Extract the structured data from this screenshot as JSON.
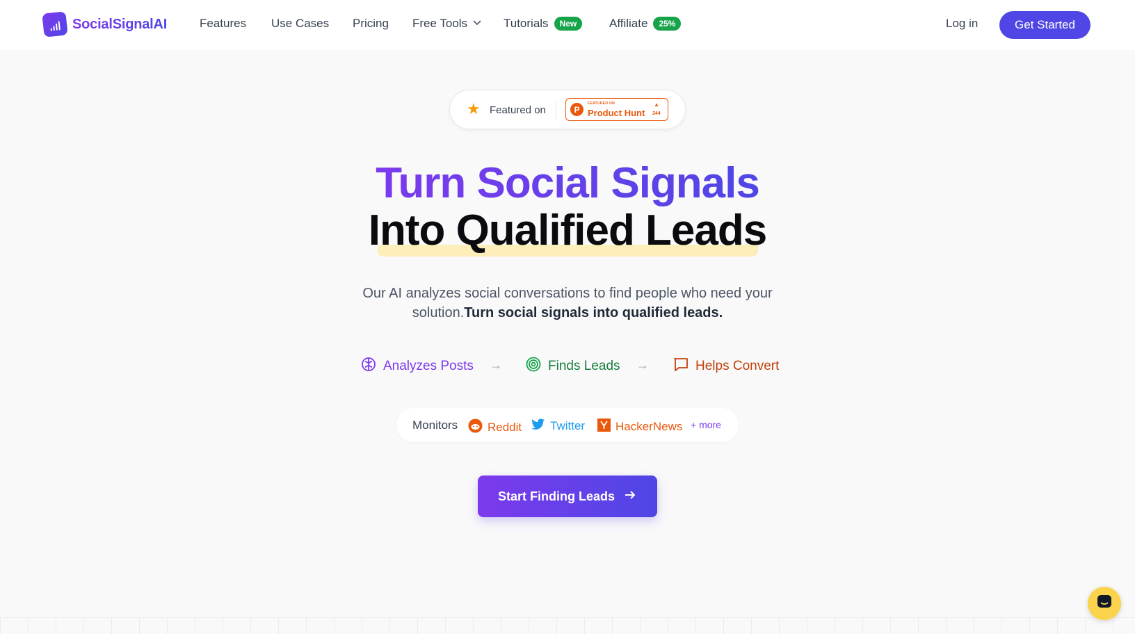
{
  "brand": {
    "name": "SocialSignalAI"
  },
  "nav": {
    "features": "Features",
    "use_cases": "Use Cases",
    "pricing": "Pricing",
    "free_tools": "Free Tools",
    "tutorials": "Tutorials",
    "tutorials_badge": "New",
    "affiliate": "Affiliate",
    "affiliate_badge": "25%",
    "login": "Log in",
    "get_started": "Get Started"
  },
  "featured": {
    "label": "Featured on",
    "ph_small": "FEATURED ON",
    "ph_name": "Product Hunt",
    "ph_count": "244"
  },
  "hero": {
    "line1": "Turn Social Signals",
    "line2": "Into Qualified Leads",
    "sub1": "Our AI analyzes social conversations to find people who need your",
    "sub2_plain": "solution.",
    "sub2_bold": "Turn social signals into qualified leads."
  },
  "flow": {
    "step1": "Analyzes Posts",
    "step2": "Finds Leads",
    "step3": "Helps Convert"
  },
  "monitors": {
    "label": "Monitors",
    "reddit": "Reddit",
    "twitter": "Twitter",
    "hackernews": "HackerNews",
    "more": "+ more"
  },
  "cta": {
    "label": "Start Finding Leads"
  },
  "colors": {
    "brand_purple": "#7c3aed",
    "brand_indigo": "#4f46e5",
    "green": "#16a34a",
    "orange": "#ea580c",
    "twitter_blue": "#1d9bf0"
  }
}
